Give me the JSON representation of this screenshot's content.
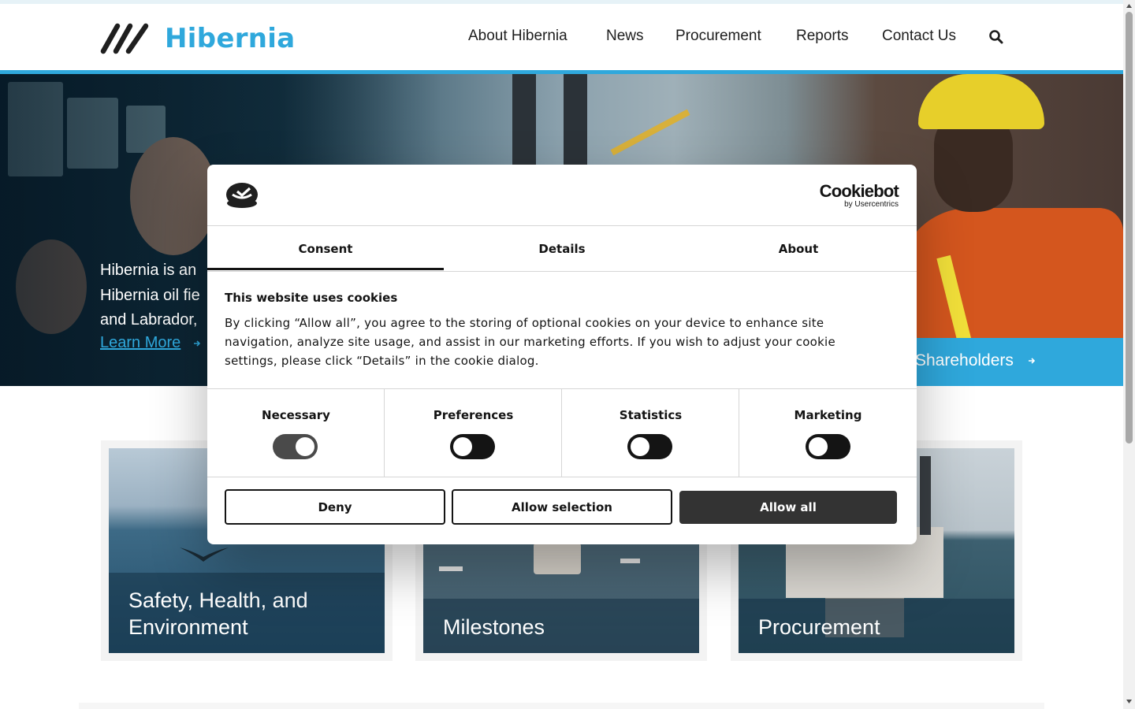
{
  "header": {
    "logo_text": "Hibernia",
    "nav": [
      {
        "label": "About Hibernia"
      },
      {
        "label": "News"
      },
      {
        "label": "Procurement"
      },
      {
        "label": "Reports"
      },
      {
        "label": "Contact Us"
      }
    ],
    "search_icon": "search-icon"
  },
  "hero": {
    "text_lines": [
      "Hibernia is an",
      "Hibernia oil fie",
      "and Labrador,"
    ],
    "learn_more": "Learn More",
    "shareholders": "Shareholders"
  },
  "cards": [
    {
      "title": "Safety, Health, and Environment"
    },
    {
      "title": "Milestones"
    },
    {
      "title": "Procurement"
    }
  ],
  "cookie_dialog": {
    "brand": "Cookiebot",
    "brand_sub": "by Usercentrics",
    "tabs": [
      {
        "label": "Consent",
        "active": true
      },
      {
        "label": "Details",
        "active": false
      },
      {
        "label": "About",
        "active": false
      }
    ],
    "heading": "This website uses cookies",
    "body": "By clicking “Allow all”, you agree to the storing of optional cookies on your device to enhance site navigation, analyze site usage, and assist in our marketing efforts. If you wish to adjust your cookie settings, please click “Details” in the cookie dialog.",
    "categories": [
      {
        "label": "Necessary",
        "enabled": true,
        "locked": true
      },
      {
        "label": "Preferences",
        "enabled": false
      },
      {
        "label": "Statistics",
        "enabled": false
      },
      {
        "label": "Marketing",
        "enabled": false
      }
    ],
    "buttons": {
      "deny": "Deny",
      "allow_selection": "Allow selection",
      "allow_all": "Allow all"
    }
  },
  "colors": {
    "brand_blue": "#2fa8dc",
    "dark": "#141414",
    "toggle_locked": "#4a4a4a",
    "button_dark": "#333333"
  }
}
